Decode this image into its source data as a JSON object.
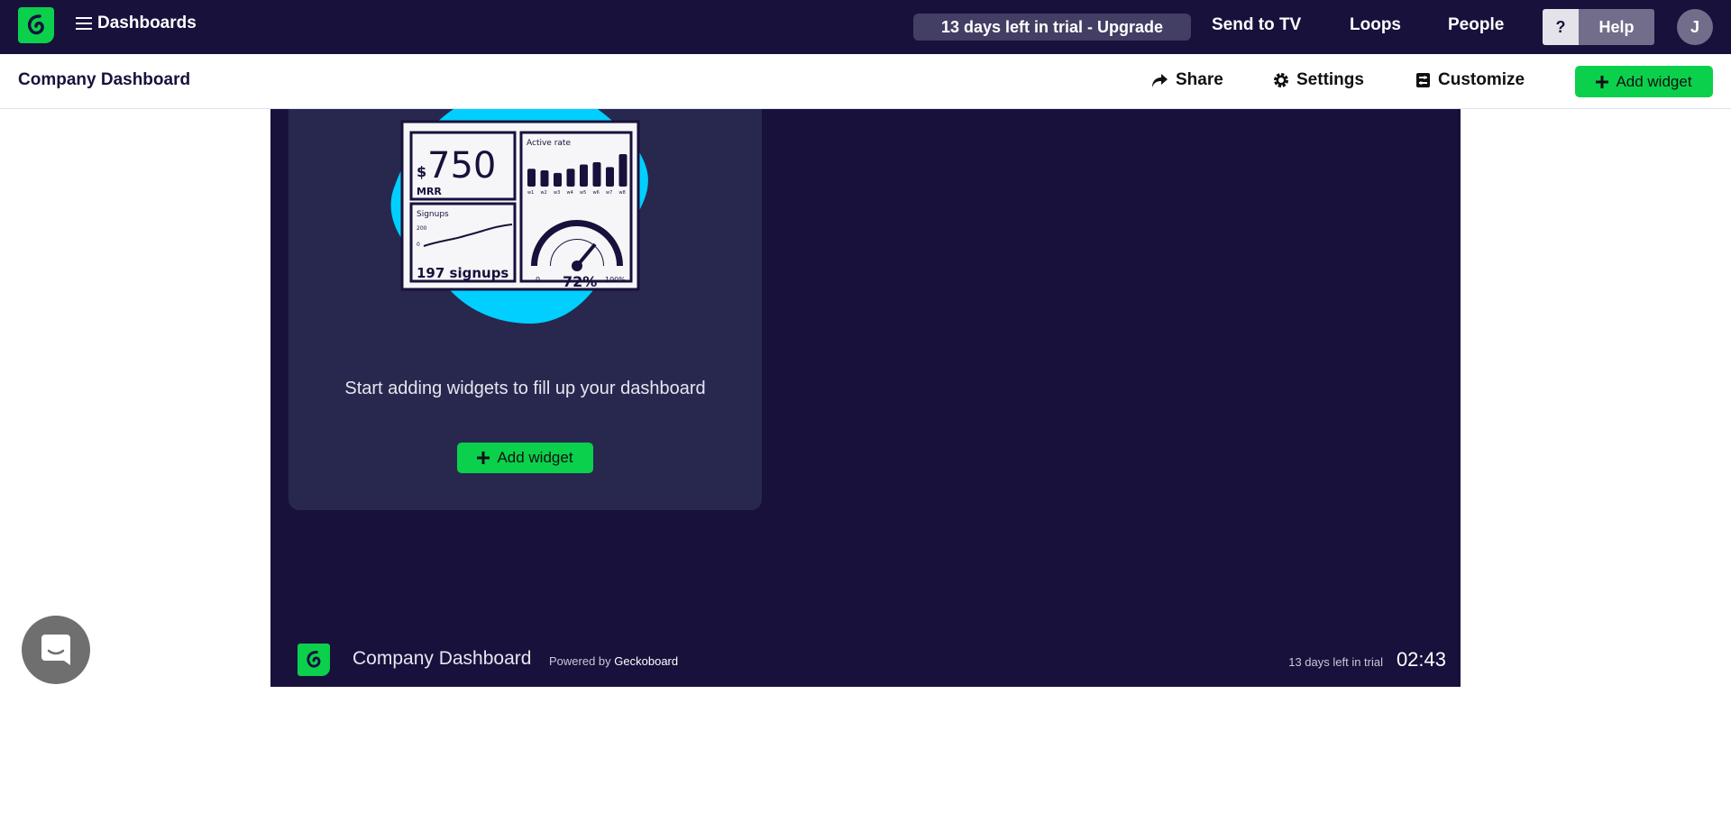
{
  "topbar": {
    "menu_label": "Dashboards",
    "trial_label": "13 days left in trial - Upgrade",
    "send_to_tv": "Send to TV",
    "loops": "Loops",
    "people": "People",
    "help_q": "?",
    "help": "Help",
    "avatar_initial": "J"
  },
  "subbar": {
    "title": "Company Dashboard",
    "share": "Share",
    "settings": "Settings",
    "customize": "Customize",
    "add_widget": "Add widget"
  },
  "card": {
    "illustration": {
      "mrr_value": "750",
      "mrr_currency": "$",
      "mrr_label": "MRR",
      "active_rate_title": "Active rate",
      "weeks": [
        "w1",
        "w2",
        "w3",
        "w4",
        "w5",
        "w6",
        "w7",
        "w8"
      ],
      "active_rate_bars": [
        0.55,
        0.5,
        0.42,
        0.55,
        0.68,
        0.75,
        0.6,
        1.0
      ],
      "signups_title": "Signups",
      "signups_max": "200",
      "signups_min": "0",
      "signups_value": "197 signups",
      "gauge_min": "0",
      "gauge_max": "100%",
      "gauge_value": "72%"
    },
    "message": "Start adding widgets to fill up your dashboard",
    "add_widget": "Add widget"
  },
  "footer": {
    "dashboard_name": "Company Dashboard",
    "powered_by": "Powered by",
    "brand": "Geckoboard",
    "trial": "13 days left in trial",
    "clock": "02:43"
  },
  "colors": {
    "nav_bg": "#18113c",
    "accent_green": "#0bd04c",
    "card_bg": "#28284f",
    "blob": "#00cfff"
  }
}
